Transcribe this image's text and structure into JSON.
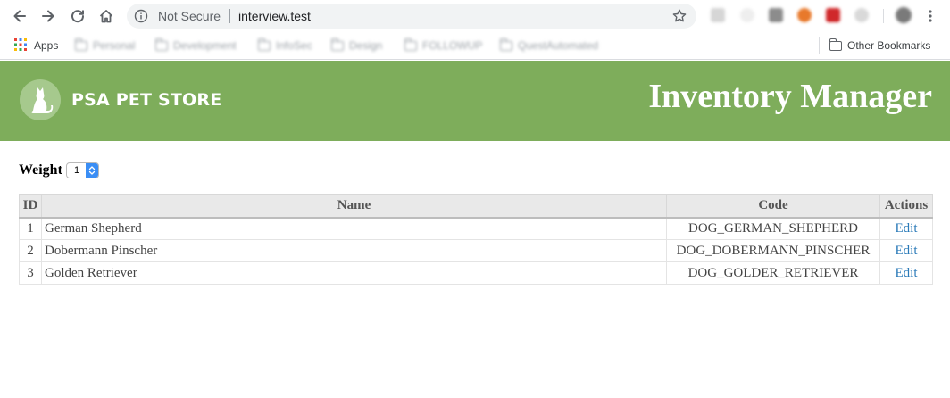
{
  "browser": {
    "security_label": "Not Secure",
    "url": "interview.test",
    "icons": {
      "back": "back-arrow-icon",
      "forward": "forward-arrow-icon",
      "reload": "reload-icon",
      "home": "home-icon",
      "info": "info-icon",
      "bookmark_star": "star-icon"
    },
    "bookmarks": [
      {
        "label": "Apps",
        "icon": "apps-grid-icon"
      },
      {
        "label": "Personal",
        "icon": "folder-icon"
      },
      {
        "label": "Development",
        "icon": "folder-icon"
      },
      {
        "label": "InfoSec",
        "icon": "folder-icon"
      },
      {
        "label": "Design",
        "icon": "folder-icon"
      },
      {
        "label": "FOLLOWUP",
        "icon": "folder-icon"
      },
      {
        "label": "QuestAutomated",
        "icon": "folder-icon"
      }
    ],
    "other_bookmarks": "Other Bookmarks"
  },
  "header": {
    "logo_text": "PSA PET STORE",
    "logo_icon": "cat-icon",
    "title": "Inventory Manager",
    "background": "#7ead5b"
  },
  "filter": {
    "label": "Weight",
    "selected": "1"
  },
  "table": {
    "columns": [
      "ID",
      "Name",
      "Code",
      "Actions"
    ],
    "rows": [
      {
        "id": "1",
        "name": "German Shepherd",
        "code": "DOG_GERMAN_SHEPHERD",
        "action": "Edit"
      },
      {
        "id": "2",
        "name": "Dobermann Pinscher",
        "code": "DOG_DOBERMANN_PINSCHER",
        "action": "Edit"
      },
      {
        "id": "3",
        "name": "Golden Retriever",
        "code": "DOG_GOLDER_RETRIEVER",
        "action": "Edit"
      }
    ]
  },
  "colors": {
    "header_green": "#7ead5b",
    "link_blue": "#2a7ab8",
    "select_blue": "#3a8ef5"
  }
}
